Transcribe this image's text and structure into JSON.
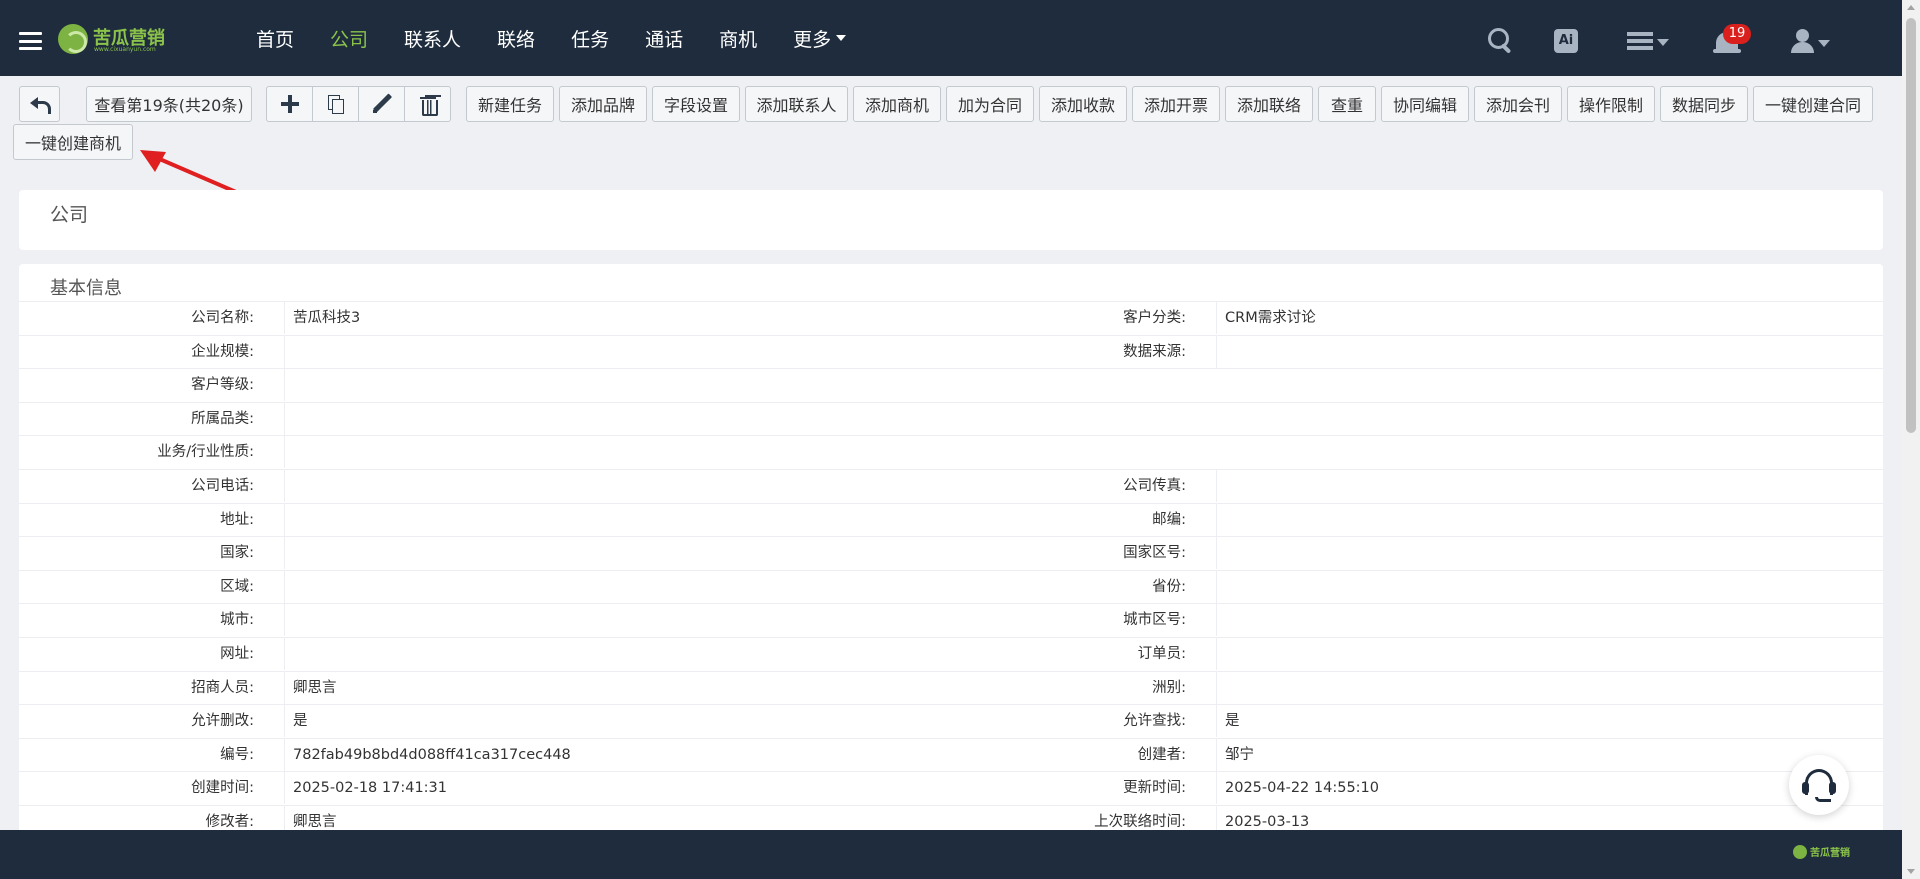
{
  "brand": {
    "name": "苦瓜营销",
    "sub": "www.cixuanyun.com",
    "color": "#8bc34a"
  },
  "nav": {
    "items": [
      {
        "label": "首页",
        "active": false
      },
      {
        "label": "公司",
        "active": true
      },
      {
        "label": "联系人",
        "active": false
      },
      {
        "label": "联络",
        "active": false
      },
      {
        "label": "任务",
        "active": false
      },
      {
        "label": "通话",
        "active": false
      },
      {
        "label": "商机",
        "active": false
      }
    ],
    "more_label": "更多",
    "ai_label": "Ai",
    "notification_count": "19"
  },
  "toolbar": {
    "back_icon": "back-arrow-icon",
    "record_label": "查看第19条(共20条)",
    "buttons": [
      "新建任务",
      "添加品牌",
      "字段设置",
      "添加联系人",
      "添加商机",
      "加为合同",
      "添加收款",
      "添加开票",
      "添加联络",
      "查重",
      "协同编辑",
      "添加会刊",
      "操作限制",
      "数据同步",
      "一键创建合同"
    ],
    "second_row_button": "一键创建商机"
  },
  "page": {
    "title": "公司",
    "section": "基本信息"
  },
  "fields": [
    {
      "l": "公司名称:",
      "v": "苦瓜科技3",
      "l2": "客户分类:",
      "v2": "CRM需求讨论"
    },
    {
      "l": "企业规模:",
      "v": "",
      "l2": "数据来源:",
      "v2": ""
    },
    {
      "l": "客户等级:",
      "v": "",
      "l2": "",
      "v2": ""
    },
    {
      "l": "所属品类:",
      "v": "",
      "l2": "",
      "v2": ""
    },
    {
      "l": "业务/行业性质:",
      "v": "",
      "l2": "",
      "v2": ""
    },
    {
      "l": "公司电话:",
      "v": "",
      "l2": "公司传真:",
      "v2": ""
    },
    {
      "l": "地址:",
      "v": "",
      "l2": "邮编:",
      "v2": ""
    },
    {
      "l": "国家:",
      "v": "",
      "l2": "国家区号:",
      "v2": ""
    },
    {
      "l": "区域:",
      "v": "",
      "l2": "省份:",
      "v2": ""
    },
    {
      "l": "城市:",
      "v": "",
      "l2": "城市区号:",
      "v2": ""
    },
    {
      "l": "网址:",
      "v": "",
      "l2": "订单员:",
      "v2": ""
    },
    {
      "l": "招商人员:",
      "v": "卿思言",
      "l2": "洲别:",
      "v2": ""
    },
    {
      "l": "允许删改:",
      "v": "是",
      "l2": "允许查找:",
      "v2": "是"
    },
    {
      "l": "编号:",
      "v": "782fab49b8bd4d088ff41ca317cec448",
      "l2": "创建者:",
      "v2": "邹宁"
    },
    {
      "l": "创建时间:",
      "v": "2025-02-18 17:41:31",
      "l2": "更新时间:",
      "v2": "2025-04-22 14:55:10"
    },
    {
      "l": "修改者:",
      "v": "卿思言",
      "l2": "上次联络时间:",
      "v2": "2025-03-13"
    }
  ],
  "footer": {
    "brand": "苦瓜营销"
  },
  "colors": {
    "topbar": "#1e2c3d",
    "active_nav": "#8bc34a",
    "badge": "#d9201c",
    "annotation_arrow": "#e02020"
  }
}
